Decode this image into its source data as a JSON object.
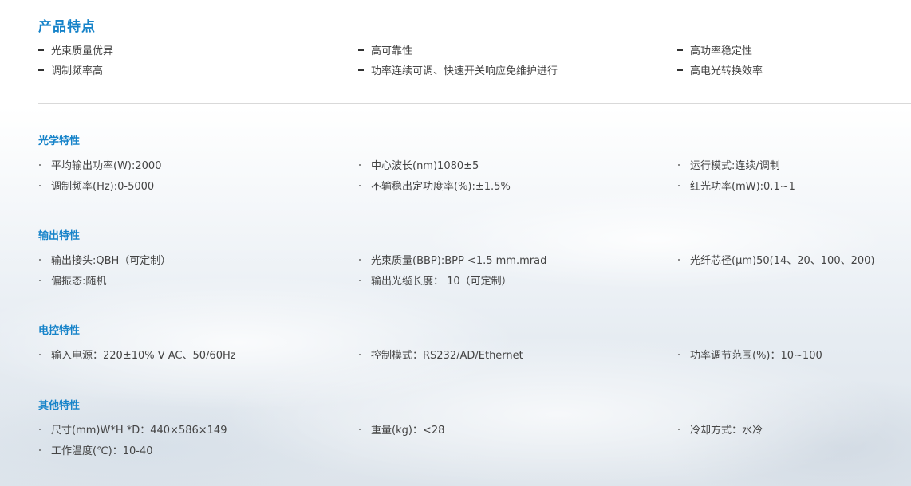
{
  "features": {
    "title": "产品特点",
    "rows": [
      [
        "光束质量优异",
        "高可靠性",
        "高功率稳定性"
      ],
      [
        "调制频率高",
        "功率连续可调、快速开关响应免维护进行",
        "高电光转换效率"
      ]
    ]
  },
  "sections": [
    {
      "title": "光学特性",
      "rows": [
        [
          "平均输出功率(W):2000",
          "中心波长(nm)1080±5",
          "运行模式:连续/调制"
        ],
        [
          "调制频率(Hz):0-5000",
          "不输稳出定功度率(%):±1.5%",
          "红光功率(mW):0.1~1"
        ]
      ]
    },
    {
      "title": "输出特性",
      "rows": [
        [
          "输出接头:QBH（可定制）",
          "光束质量(BBP):BPP <1.5 mm.mrad",
          "光纤芯径(μm)50(14、20、100、200)"
        ],
        [
          "偏振态:随机",
          "输出光缆长度： 10（可定制）",
          ""
        ]
      ]
    },
    {
      "title": "电控特性",
      "rows": [
        [
          "输入电源：220±10% V AC、50/60Hz",
          "控制模式：RS232/AD/Ethernet",
          "功率调节范围(%)：10~100"
        ]
      ]
    },
    {
      "title": "其他特性",
      "rows": [
        [
          "尺寸(mm)W*H *D：440×586×149",
          "重量(kg)：<28",
          "冷却方式：水冷"
        ],
        [
          "工作温度(℃)：10-40",
          "",
          ""
        ]
      ]
    }
  ]
}
